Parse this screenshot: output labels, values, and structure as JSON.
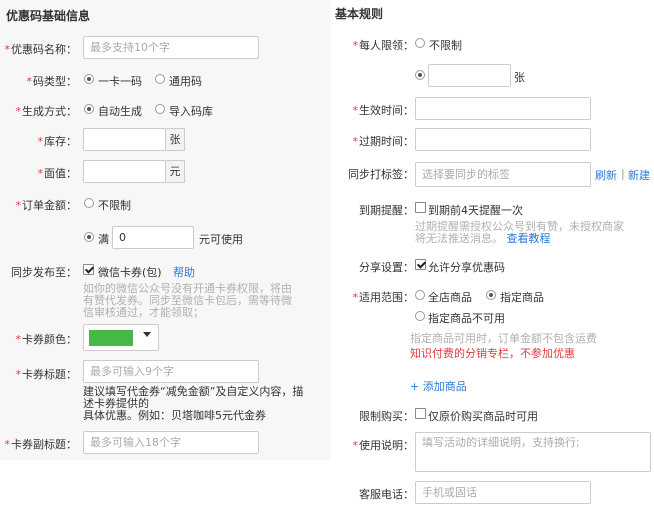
{
  "left": {
    "section_title": "优惠码基础信息",
    "name": {
      "label": "优惠码名称：",
      "placeholder": "最多支持10个字"
    },
    "code_type": {
      "label": "码类型：",
      "options": [
        "一卡一码",
        "通用码"
      ],
      "selected": 0
    },
    "gen_method": {
      "label": "生成方式：",
      "options": [
        "自动生成",
        "导入码库"
      ],
      "selected": 0
    },
    "stock": {
      "label": "库存：",
      "unit": "张"
    },
    "face_value": {
      "label": "面值：",
      "unit": "元"
    },
    "order_amount": {
      "label": "订单金额：",
      "option_unlimited": "不限制",
      "option_full": "满",
      "full_value": "0",
      "suffix": "元可使用",
      "selected": 1
    },
    "sync_publish": {
      "label": "同步发布至：",
      "checkbox": "微信卡券(包)",
      "help": "帮助",
      "checked": true,
      "hint_lines": [
        "如你的微信公众号没有开通卡券权限，将由",
        "有赞代发券。同步至微信卡包后，需等待微",
        "信审核通过，才能领取；"
      ]
    },
    "card_color": {
      "label": "卡券颜色：",
      "color": "#47b748"
    },
    "card_title": {
      "label": "卡券标题：",
      "placeholder": "最多可输入9个字",
      "note_lines": [
        "建议填写代金券“减免金额”及自定义内容，描",
        "述卡券提供的",
        "具体优惠。例如：贝塔咖啡5元代金券"
      ]
    },
    "card_subtitle": {
      "label": "卡券副标题：",
      "placeholder": "最多可输入18个字"
    }
  },
  "right": {
    "section_title": "基本规则",
    "per_person": {
      "label": "每人限领：",
      "option_unlimited": "不限制",
      "unit": "张",
      "selected": 1
    },
    "effective_time": {
      "label": "生效时间："
    },
    "expire_time": {
      "label": "过期时间："
    },
    "sync_tag": {
      "label": "同步打标签：",
      "placeholder": "选择要同步的标签",
      "refresh": "刷新",
      "sep": "|",
      "new": "新建"
    },
    "expire_remind": {
      "label": "到期提醒：",
      "checkbox": "到期前4天提醒一次",
      "checked": false,
      "hint_line1": "过期提醒需授权公众号到有赞，未授权商家",
      "hint_line2": "将无法推送消息。",
      "hint_link": "查看教程"
    },
    "share": {
      "label": "分享设置：",
      "checkbox": "允许分享优惠码",
      "checked": true
    },
    "scope": {
      "label": "适用范围：",
      "options": [
        "全店商品",
        "指定商品",
        "指定商品不可用"
      ],
      "selected": 1,
      "note": "指定商品可用时，订单金额不包含运费",
      "warn": "知识付费的分销专栏，不参加优惠",
      "add": "+ 添加商品"
    },
    "limit_buy": {
      "label": "限制购买：",
      "checkbox": "仅原价购买商品时可用",
      "checked": false
    },
    "usage": {
      "label": "使用说明：",
      "placeholder": "填写活动的详细说明，支持换行;"
    },
    "service_phone": {
      "label": "客服电话：",
      "placeholder": "手机或固话"
    }
  },
  "colors": {
    "required": "#e4393c",
    "link": "#2b7bd6",
    "swatch": "#47b748"
  },
  "icons": {
    "dropdown": "caret-down-icon"
  }
}
